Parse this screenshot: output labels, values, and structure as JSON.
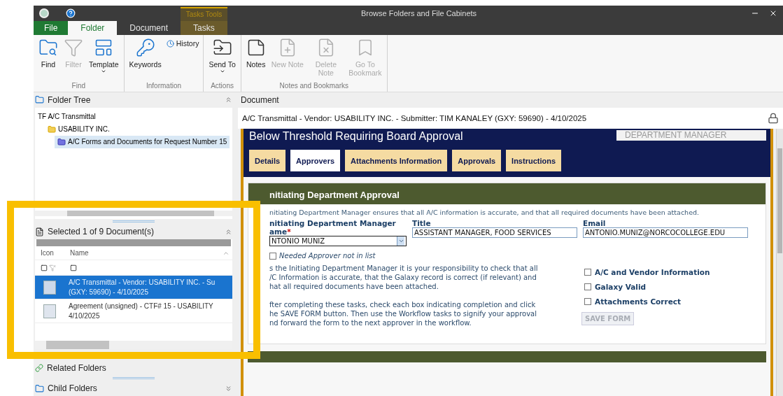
{
  "window": {
    "title": "Browse Folders and File Cabinets"
  },
  "ribbon_tabs": [
    {
      "label": "File",
      "kind": "file",
      "selected": false
    },
    {
      "label": "Folder",
      "kind": "normal",
      "selected": true
    },
    {
      "label": "Document",
      "kind": "normal",
      "selected": false
    },
    {
      "label": "Tasks",
      "kind": "context",
      "context_label": "Tasks Tools",
      "selected": false
    }
  ],
  "ribbon_groups": [
    {
      "label": "Find",
      "buttons": [
        {
          "label": "Find",
          "disabled": false,
          "dropdown": false
        },
        {
          "label": "Filter",
          "disabled": true,
          "dropdown": false
        },
        {
          "label": "Template",
          "disabled": false,
          "dropdown": true
        }
      ]
    },
    {
      "label": "Information",
      "buttons": [
        {
          "label": "Keywords",
          "disabled": false,
          "dropdown": false
        }
      ],
      "small_buttons": [
        {
          "label": "History",
          "disabled": false
        }
      ]
    },
    {
      "label": "Actions",
      "buttons": [
        {
          "label": "Send To",
          "disabled": false,
          "dropdown": true
        }
      ]
    },
    {
      "label": "Notes and Bookmarks",
      "buttons": [
        {
          "label": "Notes",
          "disabled": false,
          "dropdown": false
        },
        {
          "label": "New Note",
          "disabled": true,
          "dropdown": false
        },
        {
          "label": "Delete Note",
          "disabled": true,
          "dropdown": false
        },
        {
          "label": "Go To Bookmark",
          "disabled": true,
          "dropdown": false
        }
      ]
    }
  ],
  "folder_tree": {
    "title": "Folder Tree",
    "items": [
      {
        "label": "TF A/C Transmittal",
        "selected": false,
        "children": [
          {
            "label": "USABILITY INC.",
            "kind": "folder",
            "selected": false,
            "children": [
              {
                "label": "A/C Forms and Documents for Request Number 15",
                "kind": "request_folder",
                "selected": true
              }
            ]
          }
        ]
      }
    ]
  },
  "documents": {
    "title": "Selected 1 of 9 Document(s)",
    "columns": [
      "Icon",
      "Name"
    ],
    "rows": [
      {
        "lines": [
          "A/C Transmittal - Vendor: USABILITY INC. - Su",
          "(GXY: 59690) - 4/10/2025"
        ],
        "selected": true
      },
      {
        "lines": [
          "Agreement (unsigned) - CTF# 15 - USABILITY",
          "4/10/2025"
        ],
        "selected": false
      }
    ]
  },
  "related_folders": {
    "title": "Related Folders"
  },
  "child_folders": {
    "title": "Child Folders"
  },
  "document_pane": {
    "title": "Document",
    "document_title": "A/C Transmittal - Vendor: USABILITY INC. - Submitter: TIM KANALEY (GXY: 59690) - 4/10/2025",
    "form_heading": "Below Threshold Requiring Board Approval",
    "role_field": "DEPARTMENT MANAGER",
    "form_tabs": [
      {
        "label": "Details",
        "selected": false
      },
      {
        "label": "Approvers",
        "selected": true
      },
      {
        "label": "Attachments Information",
        "selected": false
      },
      {
        "label": "Approvals",
        "selected": false
      },
      {
        "label": "Instructions",
        "selected": false
      }
    ],
    "section": {
      "title": "nitiating Department Approval",
      "intro": "nitiating Department Manager ensures that all A/C information is accurate, and that all required documents have been attached.",
      "manager_label": [
        "nitiating Department Manager",
        "ame"
      ],
      "required_mark": "*",
      "manager_value": "NTONIO MUNIZ",
      "title_label": "Title",
      "title_value": "ASSISTANT MANAGER, FOOD SERVICES",
      "email_label": "Email",
      "email_value": "ANTONIO.MUNIZ@NORCOCOLLEGE.EDU",
      "not_in_list": {
        "label": "Needed Approver not in list",
        "checked": false
      },
      "paragraphs": [
        [
          "s the Initiating Department Manager it is your responsibility to check that all",
          "/C Information is accurate, that the Galaxy record is correct (if relevant) and",
          "hat all required documents have been attached."
        ],
        [
          "fter completing these tasks, check each box indicating completion and click",
          "he SAVE FORM button. Then use the Workflow tasks to signify your approval",
          "nd forward the form to the next approver in the workflow."
        ]
      ],
      "checks": [
        {
          "label": "A/C and Vendor Information",
          "checked": false
        },
        {
          "label": "Galaxy Valid",
          "checked": false
        },
        {
          "label": "Attachments Correct",
          "checked": false
        }
      ],
      "save_button": {
        "label": "SAVE FORM",
        "disabled": true
      }
    }
  },
  "highlight": {
    "shown": true
  }
}
